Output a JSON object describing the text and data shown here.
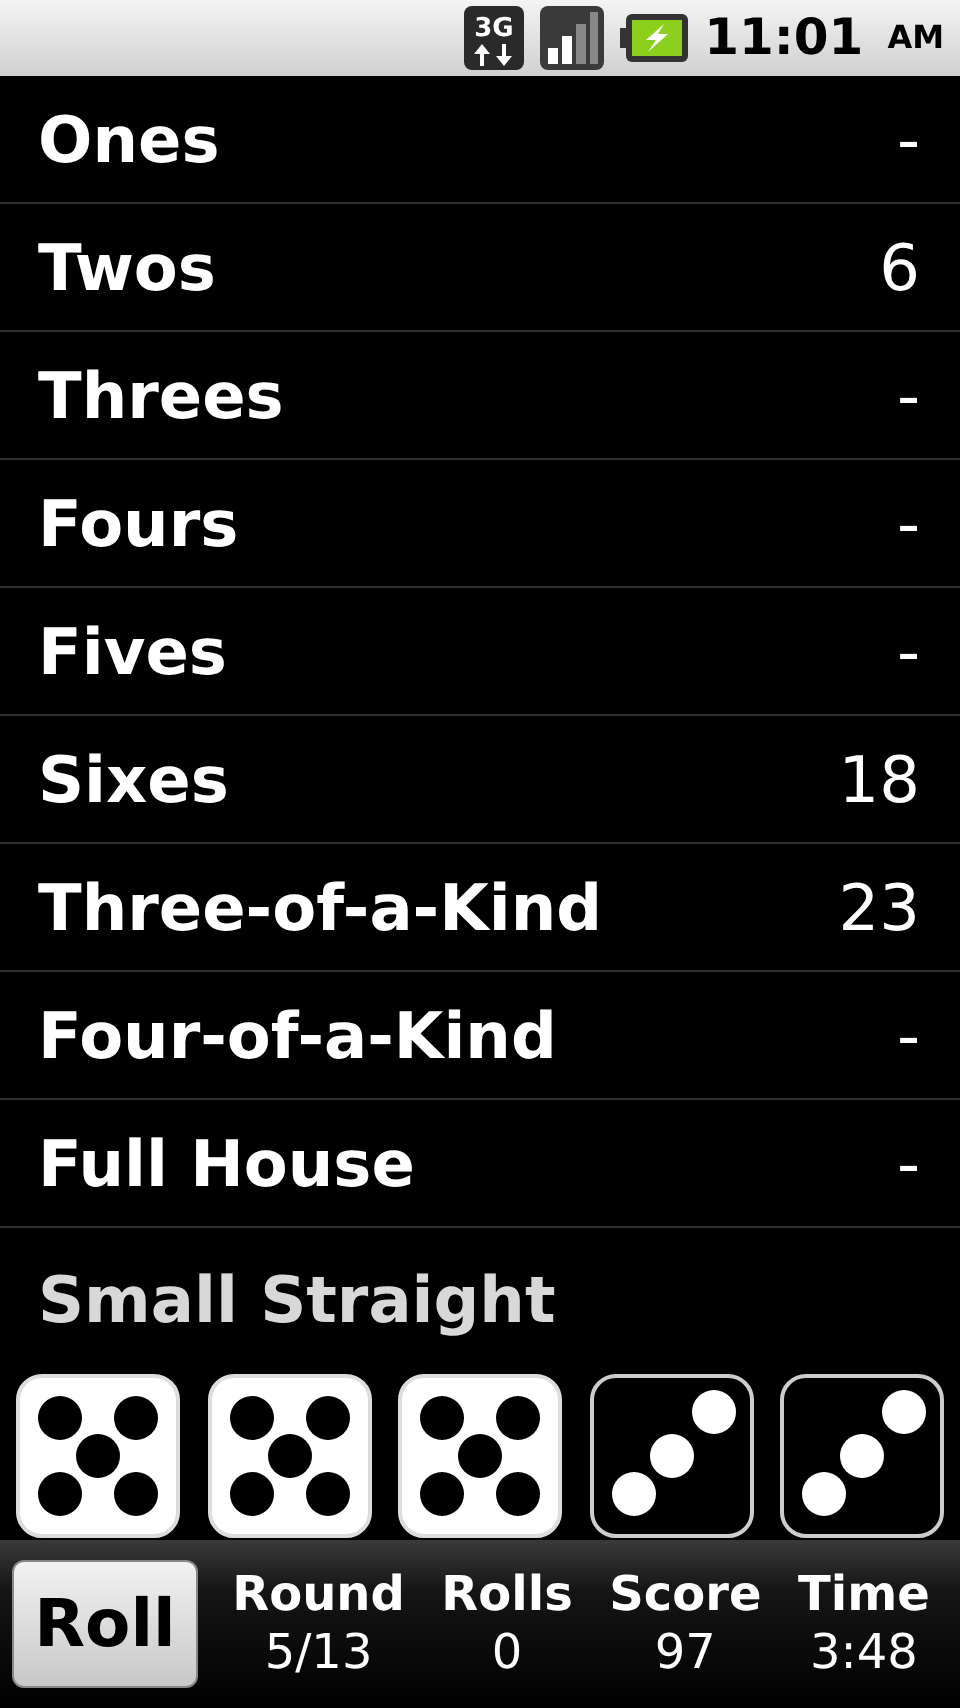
{
  "status_bar": {
    "network": "3G",
    "time": "11:01",
    "meridiem": "AM"
  },
  "categories": [
    {
      "name": "Ones",
      "score": "-"
    },
    {
      "name": "Twos",
      "score": "6"
    },
    {
      "name": "Threes",
      "score": "-"
    },
    {
      "name": "Fours",
      "score": "-"
    },
    {
      "name": "Fives",
      "score": "-"
    },
    {
      "name": "Sixes",
      "score": "18"
    },
    {
      "name": "Three-of-a-Kind",
      "score": "23"
    },
    {
      "name": "Four-of-a-Kind",
      "score": "-"
    },
    {
      "name": "Full House",
      "score": "-"
    },
    {
      "name": "Small Straight"
    }
  ],
  "dice": [
    {
      "kind": "five",
      "held": false
    },
    {
      "kind": "five",
      "held": false
    },
    {
      "kind": "five",
      "held": false
    },
    {
      "kind": "three",
      "held": true
    },
    {
      "kind": "three",
      "held": true
    }
  ],
  "roll_button": "Roll",
  "stats": [
    {
      "label": "Round",
      "value": "5/13"
    },
    {
      "label": "Rolls",
      "value": "0"
    },
    {
      "label": "Score",
      "value": "97"
    },
    {
      "label": "Time",
      "value": "3:48"
    }
  ]
}
